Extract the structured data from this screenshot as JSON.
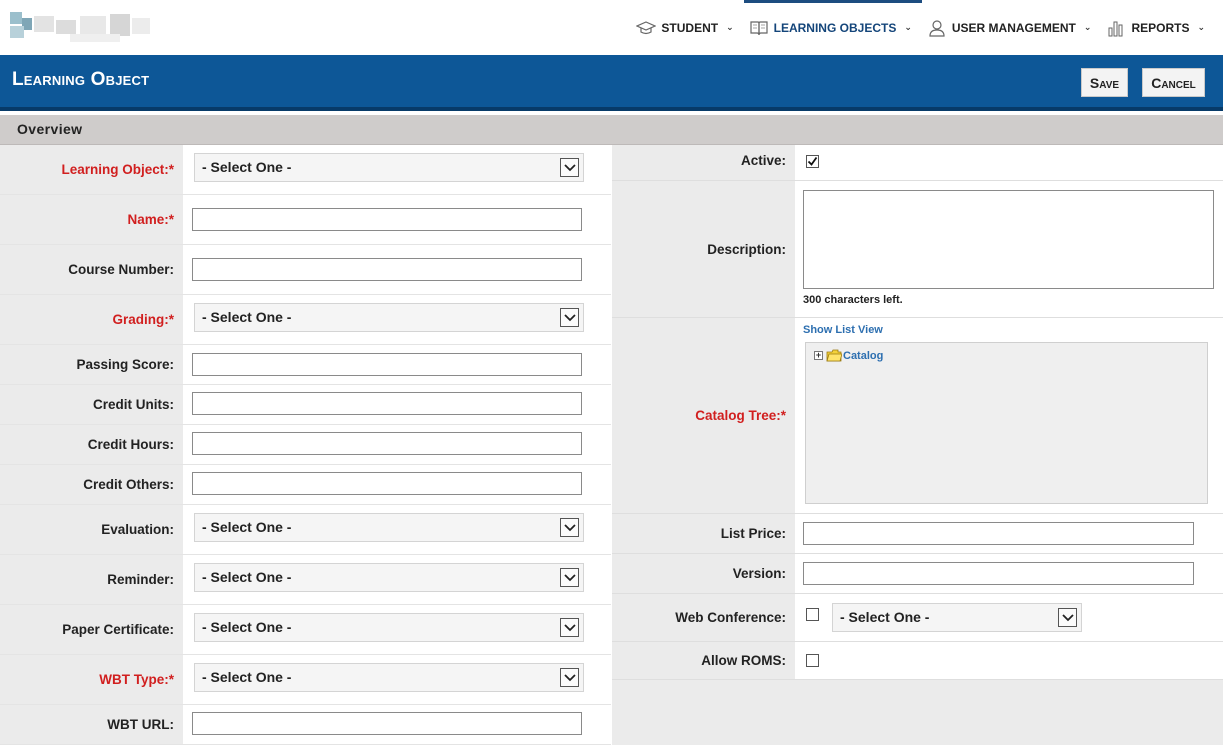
{
  "nav": {
    "items": [
      {
        "label": "STUDENT",
        "icon": "graduation-cap-icon",
        "active": false
      },
      {
        "label": "LEARNING OBJECTS",
        "icon": "book-icon",
        "active": true
      },
      {
        "label": "USER MANAGEMENT",
        "icon": "user-icon",
        "active": false
      },
      {
        "label": "REPORTS",
        "icon": "bar-chart-icon",
        "active": false
      }
    ]
  },
  "header": {
    "title": "Learning Object",
    "save_label": "Save",
    "cancel_label": "Cancel"
  },
  "section": {
    "title": "Overview"
  },
  "form_left": {
    "learning_object": {
      "label": "Learning Object:*",
      "value": "- Select One -"
    },
    "name": {
      "label": "Name:*",
      "value": ""
    },
    "course_number": {
      "label": "Course Number:",
      "value": ""
    },
    "grading": {
      "label": "Grading:*",
      "value": "- Select One -"
    },
    "passing_score": {
      "label": "Passing Score:",
      "value": ""
    },
    "credit_units": {
      "label": "Credit Units:",
      "value": ""
    },
    "credit_hours": {
      "label": "Credit Hours:",
      "value": ""
    },
    "credit_others": {
      "label": "Credit Others:",
      "value": ""
    },
    "evaluation": {
      "label": "Evaluation:",
      "value": "- Select One -"
    },
    "reminder": {
      "label": "Reminder:",
      "value": "- Select One -"
    },
    "paper_certificate": {
      "label": "Paper Certificate:",
      "value": "- Select One -"
    },
    "wbt_type": {
      "label": "WBT Type:*",
      "value": "- Select One -"
    },
    "wbt_url": {
      "label": "WBT URL:",
      "value": ""
    }
  },
  "form_right": {
    "active": {
      "label": "Active:",
      "checked": true
    },
    "description": {
      "label": "Description:",
      "value": "",
      "chars_left": "300 characters left."
    },
    "catalog_tree": {
      "label": "Catalog Tree:*",
      "show_list_view": "Show List View",
      "root_node": "Catalog"
    },
    "list_price": {
      "label": "List Price:",
      "value": ""
    },
    "version": {
      "label": "Version:",
      "value": ""
    },
    "web_conference": {
      "label": "Web Conference:",
      "checked": false,
      "value": "- Select One -"
    },
    "allow_roms": {
      "label": "Allow ROMS:",
      "checked": false
    }
  },
  "colors": {
    "header_blue": "#0d5797",
    "required_red": "#d11f1f",
    "link_blue": "#2d6fb0",
    "section_gray": "#cfcccb"
  }
}
